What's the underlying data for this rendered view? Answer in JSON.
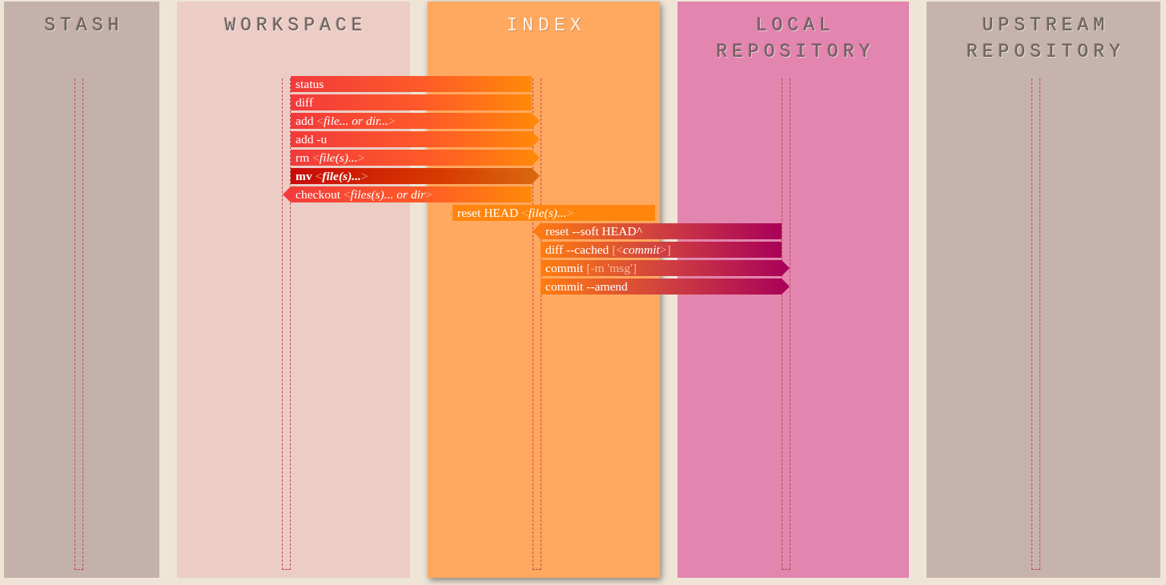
{
  "columns": [
    {
      "title": [
        "STASH"
      ],
      "color": "#c4b1ab",
      "selected": false
    },
    {
      "title": [
        "WORKSPACE"
      ],
      "color": "#ebcdc6",
      "selected": false
    },
    {
      "title": [
        "INDEX"
      ],
      "color": "#ffa85f",
      "selected": true
    },
    {
      "title": [
        "LOCAL",
        "REPOSITORY"
      ],
      "color": "#e386af",
      "selected": false
    },
    {
      "title": [
        "UPSTREAM",
        "REPOSITORY"
      ],
      "color": "#c6b3ad",
      "selected": false
    }
  ],
  "commands": [
    {
      "kind": "workspace",
      "selected": false,
      "parts": [
        {
          "kind": "cmd",
          "text": "status"
        }
      ]
    },
    {
      "kind": "workspace",
      "selected": false,
      "parts": [
        {
          "kind": "cmd",
          "text": "diff"
        }
      ]
    },
    {
      "kind": "toindex",
      "selected": false,
      "parts": [
        {
          "kind": "cmd",
          "text": "add"
        },
        {
          "kind": "punct",
          "text": "<"
        },
        {
          "kind": "arg",
          "text": "file... or dir..."
        },
        {
          "kind": "punct",
          "text": ">"
        }
      ]
    },
    {
      "kind": "toindex",
      "selected": false,
      "parts": [
        {
          "kind": "cmd",
          "text": "add -u"
        }
      ]
    },
    {
      "kind": "toindex",
      "selected": false,
      "parts": [
        {
          "kind": "cmd",
          "text": "rm"
        },
        {
          "kind": "punct",
          "text": "<"
        },
        {
          "kind": "arg",
          "text": "file(s)..."
        },
        {
          "kind": "punct",
          "text": ">"
        }
      ]
    },
    {
      "kind": "toindex",
      "selected": true,
      "parts": [
        {
          "kind": "cmd",
          "text": "mv"
        },
        {
          "kind": "punct",
          "text": "<"
        },
        {
          "kind": "arg",
          "text": "file(s)..."
        },
        {
          "kind": "punct",
          "text": ">"
        }
      ]
    },
    {
      "kind": "toworkspace",
      "selected": false,
      "parts": [
        {
          "kind": "cmd",
          "text": "checkout"
        },
        {
          "kind": "punct",
          "text": "<"
        },
        {
          "kind": "arg",
          "text": "files(s)... or dir"
        },
        {
          "kind": "punct",
          "text": ">"
        }
      ]
    },
    {
      "kind": "index",
      "selected": false,
      "parts": [
        {
          "kind": "cmd",
          "text": "reset HEAD"
        },
        {
          "kind": "punct",
          "text": "<"
        },
        {
          "kind": "arg",
          "text": "file(s)..."
        },
        {
          "kind": "punct",
          "text": ">"
        }
      ]
    },
    {
      "kind": "fromlocal",
      "selected": false,
      "parts": [
        {
          "kind": "cmd",
          "text": "reset --soft HEAD^"
        }
      ]
    },
    {
      "kind": "indexlocal",
      "selected": false,
      "parts": [
        {
          "kind": "cmd",
          "text": "diff --cached"
        },
        {
          "kind": "punct",
          "text": "[<"
        },
        {
          "kind": "arg",
          "text": "commit"
        },
        {
          "kind": "punct",
          "text": ">]"
        }
      ]
    },
    {
      "kind": "tolocal",
      "selected": false,
      "parts": [
        {
          "kind": "cmd",
          "text": "commit"
        },
        {
          "kind": "punct",
          "text": "[-m 'msg']"
        }
      ]
    },
    {
      "kind": "tolocal",
      "selected": false,
      "parts": [
        {
          "kind": "cmd",
          "text": "commit --amend"
        }
      ]
    }
  ]
}
